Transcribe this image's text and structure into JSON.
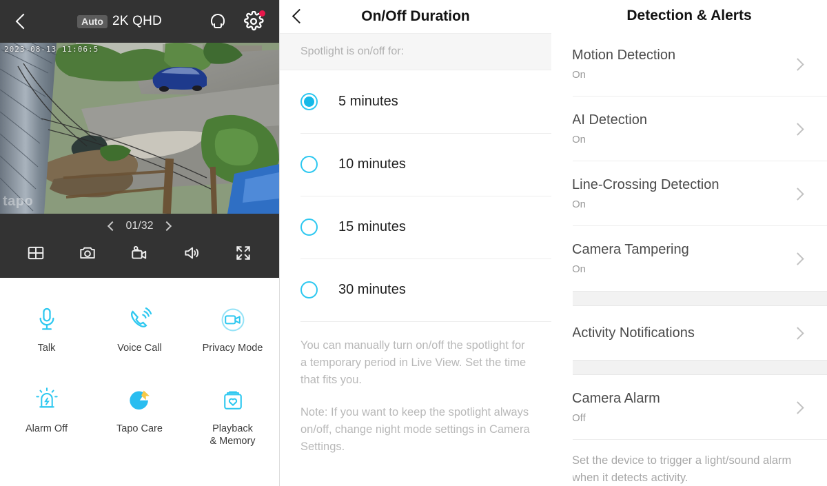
{
  "live": {
    "back_icon": "back-chevron-icon",
    "quality_badge": "Auto",
    "quality_label": "2K QHD",
    "bulb_icon": "bulb-icon",
    "gear_icon": "gear-icon",
    "video": {
      "timestamp": "2023-08-13 11:06:5",
      "watermark": "tapo"
    },
    "playback": {
      "prev_icon": "chevron-left-icon",
      "page": "01/32",
      "next_icon": "chevron-right-icon",
      "controls": [
        {
          "icon": "grid-view-icon",
          "name": "multi-view-button"
        },
        {
          "icon": "camera-snapshot-icon",
          "name": "snapshot-button"
        },
        {
          "icon": "video-record-icon",
          "name": "record-button"
        },
        {
          "icon": "speaker-volume-icon",
          "name": "volume-button"
        },
        {
          "icon": "fullscreen-expand-icon",
          "name": "fullscreen-button"
        }
      ]
    },
    "actions": [
      {
        "label": "Talk",
        "icon": "microphone-icon"
      },
      {
        "label": "Voice Call",
        "icon": "phone-call-icon"
      },
      {
        "label": "Privacy Mode",
        "icon": "privacy-camera-icon"
      },
      {
        "label": "Alarm Off",
        "icon": "alarm-bell-icon"
      },
      {
        "label": "Tapo Care",
        "icon": "tapo-care-icon"
      },
      {
        "label": "Playback\n& Memory",
        "icon": "playback-memory-icon"
      }
    ],
    "action_labels": {
      "talk": "Talk",
      "voice_call": "Voice Call",
      "privacy_mode": "Privacy Mode",
      "alarm_off": "Alarm Off",
      "tapo_care": "Tapo Care",
      "playback_l1": "Playback",
      "playback_l2": "& Memory"
    }
  },
  "duration": {
    "title": "On/Off Duration",
    "subtitle": "Spotlight is on/off for:",
    "options": [
      {
        "label": "5 minutes",
        "selected": true
      },
      {
        "label": "10 minutes",
        "selected": false
      },
      {
        "label": "15 minutes",
        "selected": false
      },
      {
        "label": "30 minutes",
        "selected": false
      }
    ],
    "note_1": "You can manually turn on/off the spotlight for a temporary period in Live View. Set the time that fits you.",
    "note_2": "Note: If you want to keep the spotlight always on/off, change night mode settings in Camera Settings."
  },
  "detection": {
    "title": "Detection & Alerts",
    "items": [
      {
        "label": "Motion Detection",
        "status": "On"
      },
      {
        "label": "AI Detection",
        "status": "On"
      },
      {
        "label": "Line-Crossing Detection",
        "status": "On"
      },
      {
        "label": "Camera Tampering",
        "status": "On"
      }
    ],
    "activity": {
      "label": "Activity Notifications"
    },
    "alarm": {
      "label": "Camera Alarm",
      "status": "Off"
    },
    "footer": "Set the device to trigger a light/sound alarm when it detects activity."
  },
  "colors": {
    "accent_cyan": "#15b9e8",
    "dark_bar": "#333333",
    "alert_red": "#e8174b",
    "tapo_yellow": "#f7c948"
  }
}
